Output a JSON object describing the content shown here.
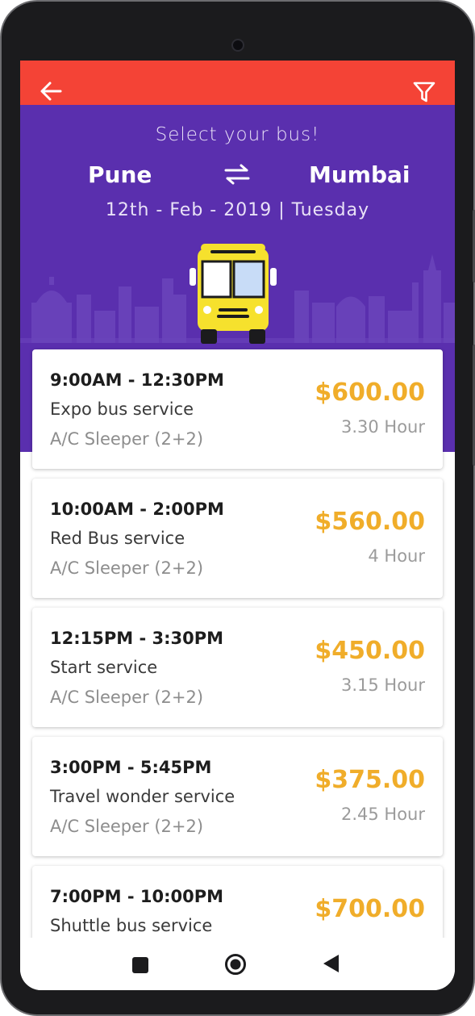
{
  "header": {
    "title": "Select your bus!",
    "from_city": "Pune",
    "to_city": "Mumbai",
    "date": "12th - Feb - 2019 | Tuesday"
  },
  "icons": {
    "back": "arrow-left-icon",
    "filter": "filter-icon",
    "swap": "swap-arrows-icon"
  },
  "colors": {
    "appbar": "#f44336",
    "hero": "#5a2fae",
    "price": "#f0ad2a"
  },
  "buses": [
    {
      "time": "9:00AM - 12:30PM",
      "name": "Expo bus service",
      "type": "A/C Sleeper (2+2)",
      "price": "$600.00",
      "duration": "3.30 Hour"
    },
    {
      "time": "10:00AM - 2:00PM",
      "name": "Red Bus service",
      "type": "A/C Sleeper (2+2)",
      "price": "$560.00",
      "duration": "4 Hour"
    },
    {
      "time": "12:15PM - 3:30PM",
      "name": "Start service",
      "type": "A/C Sleeper (2+2)",
      "price": "$450.00",
      "duration": "3.15 Hour"
    },
    {
      "time": "3:00PM - 5:45PM",
      "name": "Travel wonder service",
      "type": "A/C Sleeper (2+2)",
      "price": "$375.00",
      "duration": "2.45 Hour"
    },
    {
      "time": "7:00PM - 10:00PM",
      "name": "Shuttle bus service",
      "type": "",
      "price": "$700.00",
      "duration": ""
    }
  ]
}
